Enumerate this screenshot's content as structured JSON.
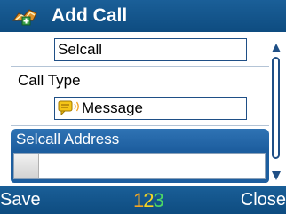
{
  "title": {
    "text": "Add Call",
    "icon": "add-call-icon"
  },
  "fields": {
    "call_name_value": "Selcall",
    "call_type_label": "Call Type",
    "call_type_value": "Message",
    "call_type_icon": "message-icon",
    "selcall_address_label": "Selcall Address",
    "selcall_address_value": ""
  },
  "softkeys": {
    "left": "Save",
    "center": {
      "digit1": "1",
      "digit2": "2",
      "digit3": "3",
      "colors": [
        "#f5a623",
        "#f5d623",
        "#4cd964"
      ]
    },
    "right": "Close"
  },
  "colors": {
    "header_blue": "#1a5f98",
    "focus_blue": "#2f73b4",
    "border_blue": "#1f4f86"
  }
}
